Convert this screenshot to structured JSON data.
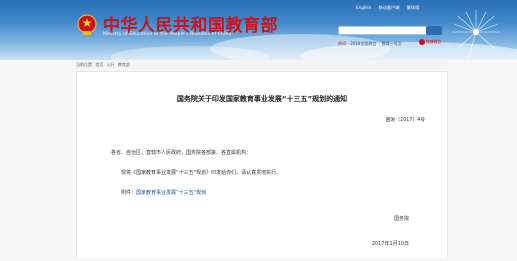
{
  "header": {
    "site_title": "中华人民共和国教育部",
    "site_subtitle": "Ministry of Education of the People's Republic of China",
    "top_links": [
      "English",
      "移动客户端",
      "繁体版"
    ],
    "search_placeholder": "",
    "hot_words_label": "热词",
    "hot_words": [
      "2018全国两会",
      "教育一号文"
    ],
    "badge_text": "微博微信"
  },
  "breadcrumb": [
    "当前位置",
    "首页",
    "公开",
    "教育部"
  ],
  "document": {
    "title": "国务院关于印发国家教育事业发展“十三五”规划的通知",
    "number": "国发〔2017〕4号",
    "addressee": "各省、自治区、直辖市人民政府，国务院各部委、各直属机构：",
    "body": "现将《国家教育事业发展“十三五”规划》印发给你们，请认真贯彻执行。",
    "attachment_label": "附件：",
    "attachment_link": "国家教育事业发展“十三五”规划",
    "issuer": "国务院",
    "date": "2017年1月10日"
  },
  "colors": {
    "title_red": "#c8141c",
    "header_blue": "#2a6fb6",
    "link_blue": "#1a4fa0"
  }
}
